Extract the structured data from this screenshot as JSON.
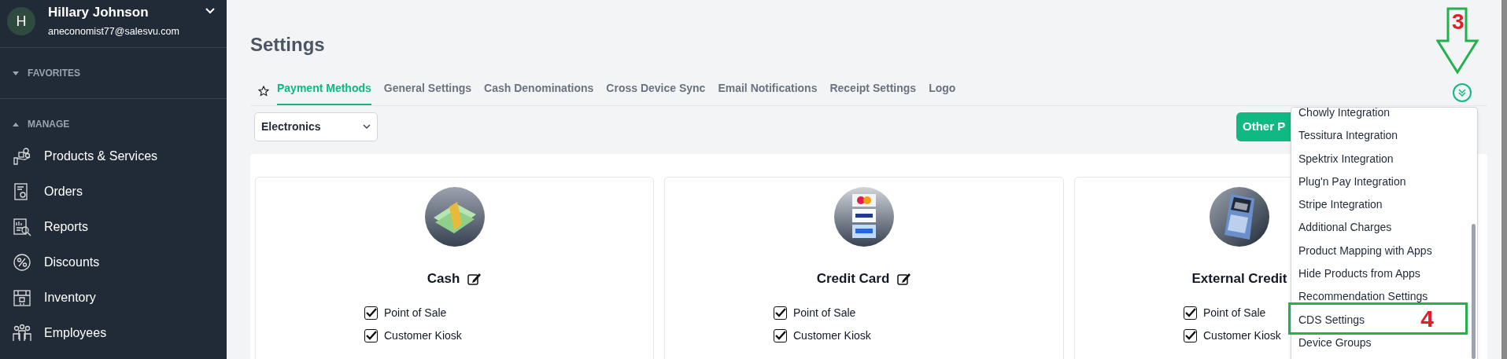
{
  "user": {
    "initial": "H",
    "name": "Hillary Johnson",
    "email": "aneconomist77@salesvu.com"
  },
  "sidebar": {
    "sections": [
      {
        "label": "FAVORITES",
        "expanded": false
      },
      {
        "label": "MANAGE",
        "expanded": true,
        "items": [
          {
            "label": "Products & Services"
          },
          {
            "label": "Orders"
          },
          {
            "label": "Reports"
          },
          {
            "label": "Discounts"
          },
          {
            "label": "Inventory"
          },
          {
            "label": "Employees"
          }
        ]
      }
    ]
  },
  "page_title": "Settings",
  "favorite": {
    "starred": false
  },
  "tabs": [
    {
      "label": "Payment Methods",
      "selected": true
    },
    {
      "label": "General Settings",
      "selected": false
    },
    {
      "label": "Cash Denominations",
      "selected": false
    },
    {
      "label": "Cross Device Sync",
      "selected": false
    },
    {
      "label": "Email Notifications",
      "selected": false
    },
    {
      "label": "Receipt Settings",
      "selected": false
    },
    {
      "label": "Logo",
      "selected": false
    }
  ],
  "store_select": {
    "value": "Electronics"
  },
  "other_button": {
    "label": "Other P"
  },
  "payment_methods": [
    {
      "name": "Cash",
      "editable": true,
      "options": [
        {
          "label": "Point of Sale",
          "checked": true
        },
        {
          "label": "Customer Kiosk",
          "checked": true
        }
      ]
    },
    {
      "name": "Credit Card",
      "editable": true,
      "options": [
        {
          "label": "Point of Sale",
          "checked": true
        },
        {
          "label": "Customer Kiosk",
          "checked": true
        }
      ]
    },
    {
      "name": "External Credit",
      "options": [
        {
          "label": "Point of Sale",
          "checked": true
        },
        {
          "label": "Customer Kiosk",
          "checked": true
        }
      ]
    }
  ],
  "more_menu": {
    "expanded": true,
    "items": [
      {
        "label": "Chowly Integration"
      },
      {
        "label": "Tessitura Integration"
      },
      {
        "label": "Spektrix Integration"
      },
      {
        "label": "Plug'n Pay Integration"
      },
      {
        "label": "Stripe Integration"
      },
      {
        "label": "Additional Charges"
      },
      {
        "label": "Product Mapping with Apps"
      },
      {
        "label": "Hide Products from Apps"
      },
      {
        "label": "Recommendation Settings"
      },
      {
        "label": "CDS Settings"
      },
      {
        "label": "Device Groups"
      }
    ]
  },
  "annotations": [
    {
      "kind": "arrow",
      "label": "3"
    },
    {
      "kind": "box",
      "label": "4"
    }
  ]
}
